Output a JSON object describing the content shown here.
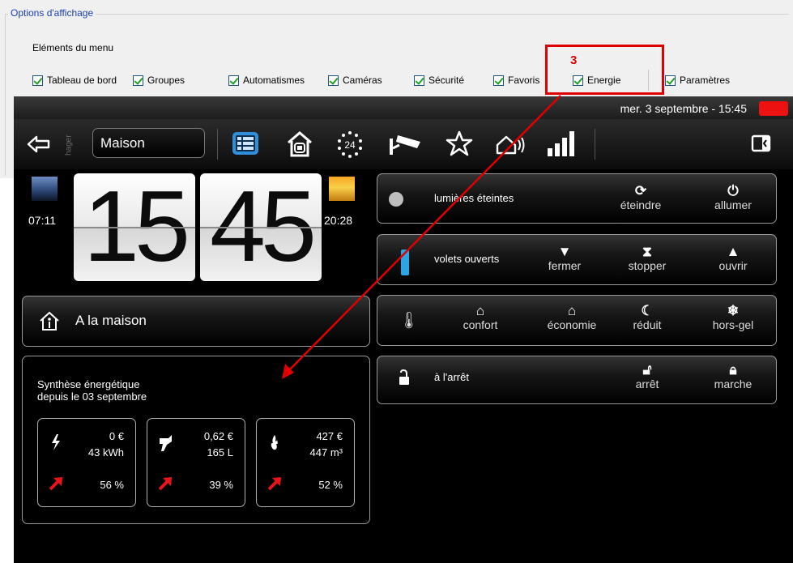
{
  "options": {
    "legend": "Options d'affichage",
    "menu_label": "Eléments du menu",
    "items": [
      {
        "label": "Tableau de bord",
        "checked": true
      },
      {
        "label": "Groupes",
        "checked": true
      },
      {
        "label": "Automatismes",
        "checked": true
      },
      {
        "label": "Caméras",
        "checked": true
      },
      {
        "label": "Sécurité",
        "checked": true
      },
      {
        "label": "Favoris",
        "checked": true
      },
      {
        "label": "Energie",
        "checked": true
      },
      {
        "label": "Paramètres",
        "checked": true
      }
    ]
  },
  "annotation": {
    "number": "3",
    "color": "#e00000"
  },
  "status": {
    "datetime": "mer. 3 septembre - 15:45",
    "alert_color": "#e11111"
  },
  "toolbar": {
    "house": "Maison",
    "brand": "hager",
    "icons": [
      "back-arrow-icon",
      "dashboard-icon",
      "home-groups-icon",
      "automation-24-icon",
      "camera-icon",
      "star-icon",
      "security-icon",
      "energy-bars-icon",
      "exit-icon"
    ],
    "accent": "#2f8fd8"
  },
  "clock": {
    "sunrise": "07:11",
    "sunset": "20:28",
    "hours": "15",
    "minutes": "45"
  },
  "mode": {
    "label": "A la maison"
  },
  "energy": {
    "title_line1": "Synthèse énergétique",
    "title_line2": "depuis le 03 septembre",
    "cards": [
      {
        "type": "electricity",
        "cost": "0 €",
        "quantity": "43 kWh",
        "percent": "56 %"
      },
      {
        "type": "water",
        "cost": "0,62 €",
        "quantity": "165 L",
        "percent": "39 %"
      },
      {
        "type": "gas",
        "cost": "427 €",
        "quantity": "447 m³",
        "percent": "52 %"
      }
    ],
    "trend_color": "#e8141a"
  },
  "lights": {
    "status": "lumières éteintes",
    "off_label": "éteindre",
    "on_label": "allumer"
  },
  "shutters": {
    "status": "volets ouverts",
    "close_label": "fermer",
    "stop_label": "stopper",
    "open_label": "ouvrir",
    "indicator_color": "#2aa5e6"
  },
  "heating": {
    "comfort": "confort",
    "economy": "économie",
    "reduced": "réduit",
    "frost": "hors-gel"
  },
  "alarm": {
    "status": "à l'arrêt",
    "off_label": "arrêt",
    "on_label": "marche"
  }
}
